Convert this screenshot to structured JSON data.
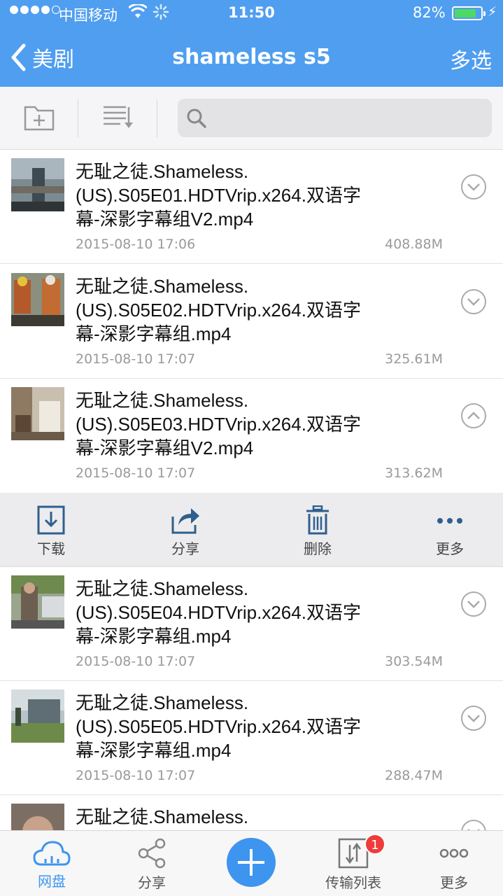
{
  "status_bar": {
    "carrier": "中国移动",
    "time": "11:50",
    "battery_percent": "82%",
    "battery_level": 0.82,
    "signal_bars_filled": 4
  },
  "nav": {
    "back_label": "美剧",
    "title": "shameless s5",
    "multi_select_label": "多选"
  },
  "search": {
    "placeholder": ""
  },
  "files": [
    {
      "name": "无耻之徒.Shameless.(US).S05E01.HDTVrip.x264.双语字幕-深影字幕组V2.mp4",
      "date": "2015-08-10 17:06",
      "size": "408.88M",
      "expanded": false
    },
    {
      "name": "无耻之徒.Shameless.(US).S05E02.HDTVrip.x264.双语字幕-深影字幕组.mp4",
      "date": "2015-08-10 17:07",
      "size": "325.61M",
      "expanded": false
    },
    {
      "name": "无耻之徒.Shameless.(US).S05E03.HDTVrip.x264.双语字幕-深影字幕组V2.mp4",
      "date": "2015-08-10 17:07",
      "size": "313.62M",
      "expanded": true
    },
    {
      "name": "无耻之徒.Shameless.(US).S05E04.HDTVrip.x264.双语字幕-深影字幕组.mp4",
      "date": "2015-08-10 17:07",
      "size": "303.54M",
      "expanded": false
    },
    {
      "name": "无耻之徒.Shameless.(US).S05E05.HDTVrip.x264.双语字幕-深影字幕组.mp4",
      "date": "2015-08-10 17:07",
      "size": "288.47M",
      "expanded": false
    },
    {
      "name": "无耻之徒.Shameless.",
      "date": "",
      "size": "",
      "expanded": false
    }
  ],
  "file_name_lines": [
    [
      "无耻之徒.Shameless.",
      "(US).S05E01.HDTVrip.x264.双语字",
      "幕-深影字幕组V2.mp4"
    ],
    [
      "无耻之徒.Shameless.",
      "(US).S05E02.HDTVrip.x264.双语字",
      "幕-深影字幕组.mp4"
    ],
    [
      "无耻之徒.Shameless.",
      "(US).S05E03.HDTVrip.x264.双语字",
      "幕-深影字幕组V2.mp4"
    ],
    [
      "无耻之徒.Shameless.",
      "(US).S05E04.HDTVrip.x264.双语字",
      "幕-深影字幕组.mp4"
    ],
    [
      "无耻之徒.Shameless.",
      "(US).S05E05.HDTVrip.x264.双语字",
      "幕-深影字幕组.mp4"
    ],
    [
      "无耻之徒.Shameless."
    ]
  ],
  "actions": {
    "download": "下载",
    "share": "分享",
    "delete": "删除",
    "more": "更多"
  },
  "tabbar": {
    "cloud": "网盘",
    "share": "分享",
    "transfer": "传输列表",
    "transfer_badge": "1",
    "more": "更多"
  },
  "colors": {
    "accent": "#4f9ef0",
    "tab_active": "#3d95ef",
    "badge": "#ee3b3b",
    "battery": "#4cd964"
  }
}
